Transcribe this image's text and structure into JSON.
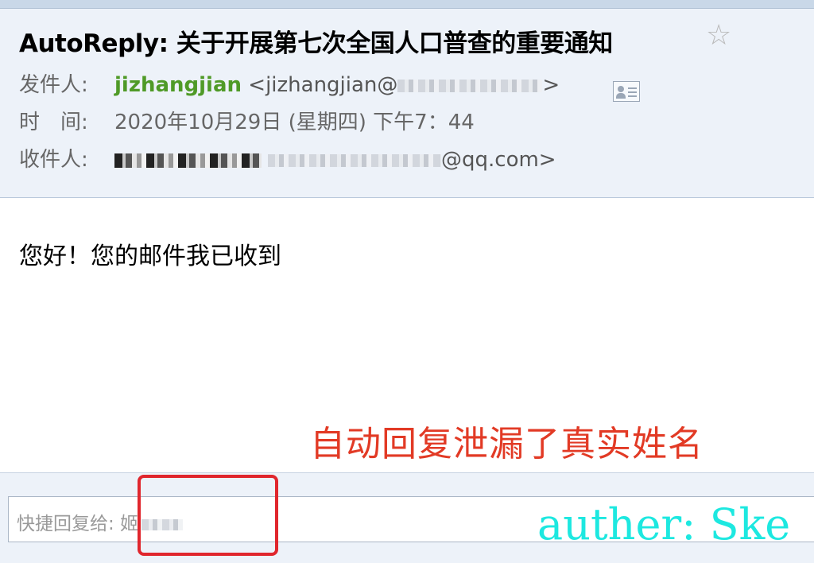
{
  "email": {
    "subject": "AutoReply: 关于开展第七次全国人口普查的重要通知",
    "star_icon": "star-outline-icon",
    "from": {
      "label": "发件人:",
      "name": "jizhangjian",
      "address_prefix": "<jizhangjian@",
      "address_suffix": ">"
    },
    "time": {
      "label": "时　间:",
      "value": "2020年10月29日 (星期四) 下午7：44"
    },
    "to": {
      "label": "收件人:",
      "address_suffix": "@qq.com>"
    },
    "body": "您好！您的邮件我已收到"
  },
  "annotation": {
    "text": "自动回复泄漏了真实姓名",
    "color": "#e23a25"
  },
  "quick_reply": {
    "placeholder": "快捷回复给: 姬"
  },
  "watermark": {
    "text": "auther: Ske",
    "color": "#1de8e0"
  },
  "colors": {
    "header_bg": "#edf2f9",
    "sender_green": "#4f9a27",
    "highlight_red": "#e0262d"
  }
}
